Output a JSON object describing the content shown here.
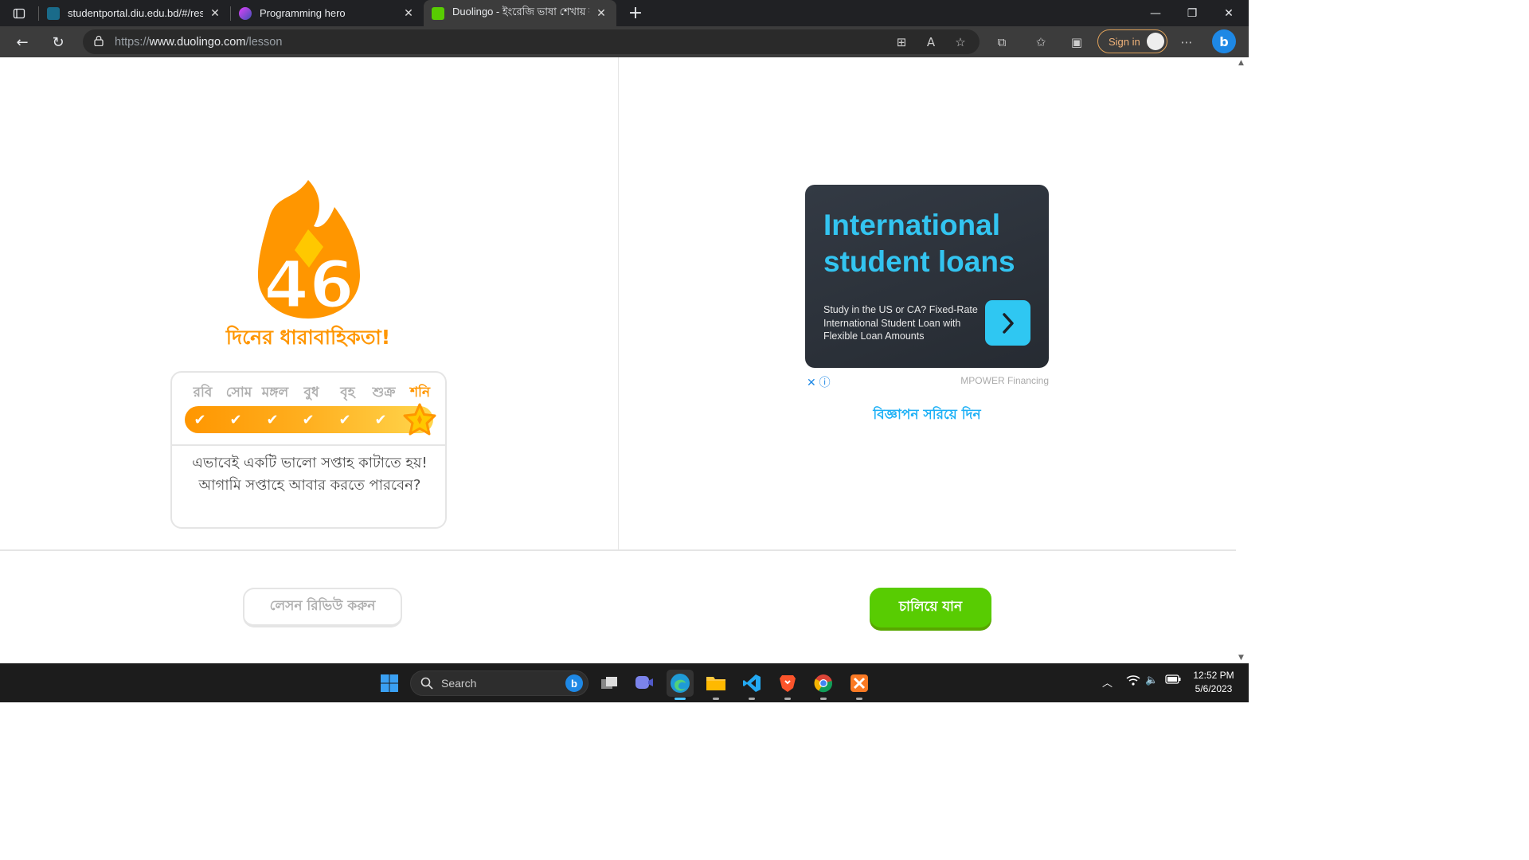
{
  "browser": {
    "tabs": [
      {
        "title": "studentportal.diu.edu.bd/#/resul",
        "active": false
      },
      {
        "title": "Programming hero",
        "active": false
      },
      {
        "title": "Duolingo - ইংরেজি ভাষা শেখায় ফ্",
        "active": true
      }
    ],
    "url_prefix": "https://",
    "url_host": "www.duolingo.com",
    "url_path": "/lesson",
    "signin_label": "Sign in"
  },
  "streak": {
    "count": "46",
    "title": "দিনের ধারাবাহিকতা!",
    "days": [
      "রবি",
      "সোম",
      "মঙ্গল",
      "বুধ",
      "বৃহ",
      "শুক্র",
      "শনি"
    ],
    "completed_days": 6,
    "today_index": 6,
    "message": "এভাবেই একটি ভালো সপ্তাহ কাটাতে হয়! আগামি সপ্তাহে আবার করতে পারবেন?"
  },
  "ad": {
    "title": "International student loans",
    "body": "Study in the US or CA? Fixed-Rate International Student Loan with Flexible Loan Amounts",
    "sponsor": "MPOWER Financing",
    "remove_label": "বিজ্ঞাপন সরিয়ে দিন"
  },
  "footer": {
    "review_label": "লেসন রিভিউ করুন",
    "continue_label": "চালিয়ে যান"
  },
  "taskbar": {
    "search_label": "Search",
    "time": "12:52 PM",
    "date": "5/6/2023"
  },
  "colors": {
    "streak_orange": "#ff9600",
    "continue_green": "#58cc02",
    "ad_blue": "#33c4f0",
    "link_blue": "#1cb0f6"
  }
}
